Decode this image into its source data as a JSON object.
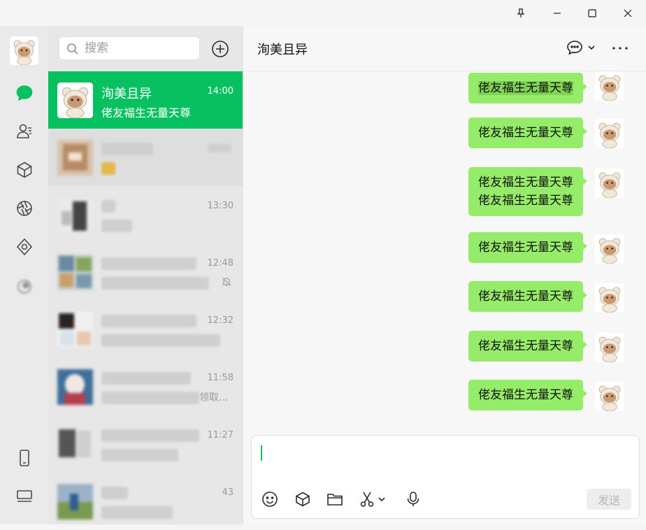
{
  "window": {
    "pin_label": "pin",
    "min_label": "minimize",
    "max_label": "maximize",
    "close_label": "close"
  },
  "nav": {
    "items": [
      {
        "name": "chats",
        "icon": "chat-bubble-icon",
        "active": true
      },
      {
        "name": "contacts",
        "icon": "contacts-icon"
      },
      {
        "name": "favorites",
        "icon": "cube-icon"
      },
      {
        "name": "moments",
        "icon": "aperture-icon"
      },
      {
        "name": "channels",
        "icon": "diamond-icon"
      },
      {
        "name": "mini-programs",
        "icon": "blurred-icon"
      },
      {
        "name": "phone",
        "icon": "phone-icon"
      },
      {
        "name": "more",
        "icon": "menu-icon"
      }
    ]
  },
  "search": {
    "placeholder": "搜索"
  },
  "chat_list": [
    {
      "name": "洵美且异",
      "time": "14:00",
      "preview": "佬友福生无量天尊",
      "active": true
    },
    {
      "name": "",
      "time": "",
      "preview": "",
      "blurred": true
    },
    {
      "name": "",
      "time": "13:30",
      "preview": "",
      "blurred": true
    },
    {
      "name": "",
      "time": "12:48",
      "preview": "",
      "blurred": true,
      "muted": true
    },
    {
      "name": "",
      "time": "12:32",
      "preview": "",
      "blurred": true
    },
    {
      "name": "",
      "time": "11:58",
      "preview": "领取...",
      "blurred": true
    },
    {
      "name": "",
      "time": "11:27",
      "preview": "",
      "blurred": true
    },
    {
      "name": "",
      "time": "43",
      "preview": "",
      "blurred": true
    }
  ],
  "conversation": {
    "title": "洵美且异",
    "messages": [
      {
        "text": "佬友福生无量天尊",
        "highlighted": true
      },
      {
        "text": "佬友福生无量天尊"
      },
      {
        "text": "佬友福生无量天尊\n佬友福生无量天尊",
        "lines": [
          "佬友福生无量天尊",
          "佬友福生无量天尊"
        ]
      },
      {
        "text": "佬友福生无量天尊"
      },
      {
        "text": "佬友福生无量天尊"
      },
      {
        "text": "佬友福生无量天尊"
      },
      {
        "text": "佬友福生无量天尊"
      }
    ]
  },
  "composer": {
    "value": "",
    "send_label": "发送"
  },
  "colors": {
    "accent": "#07c160",
    "bubble": "#95ec69"
  }
}
